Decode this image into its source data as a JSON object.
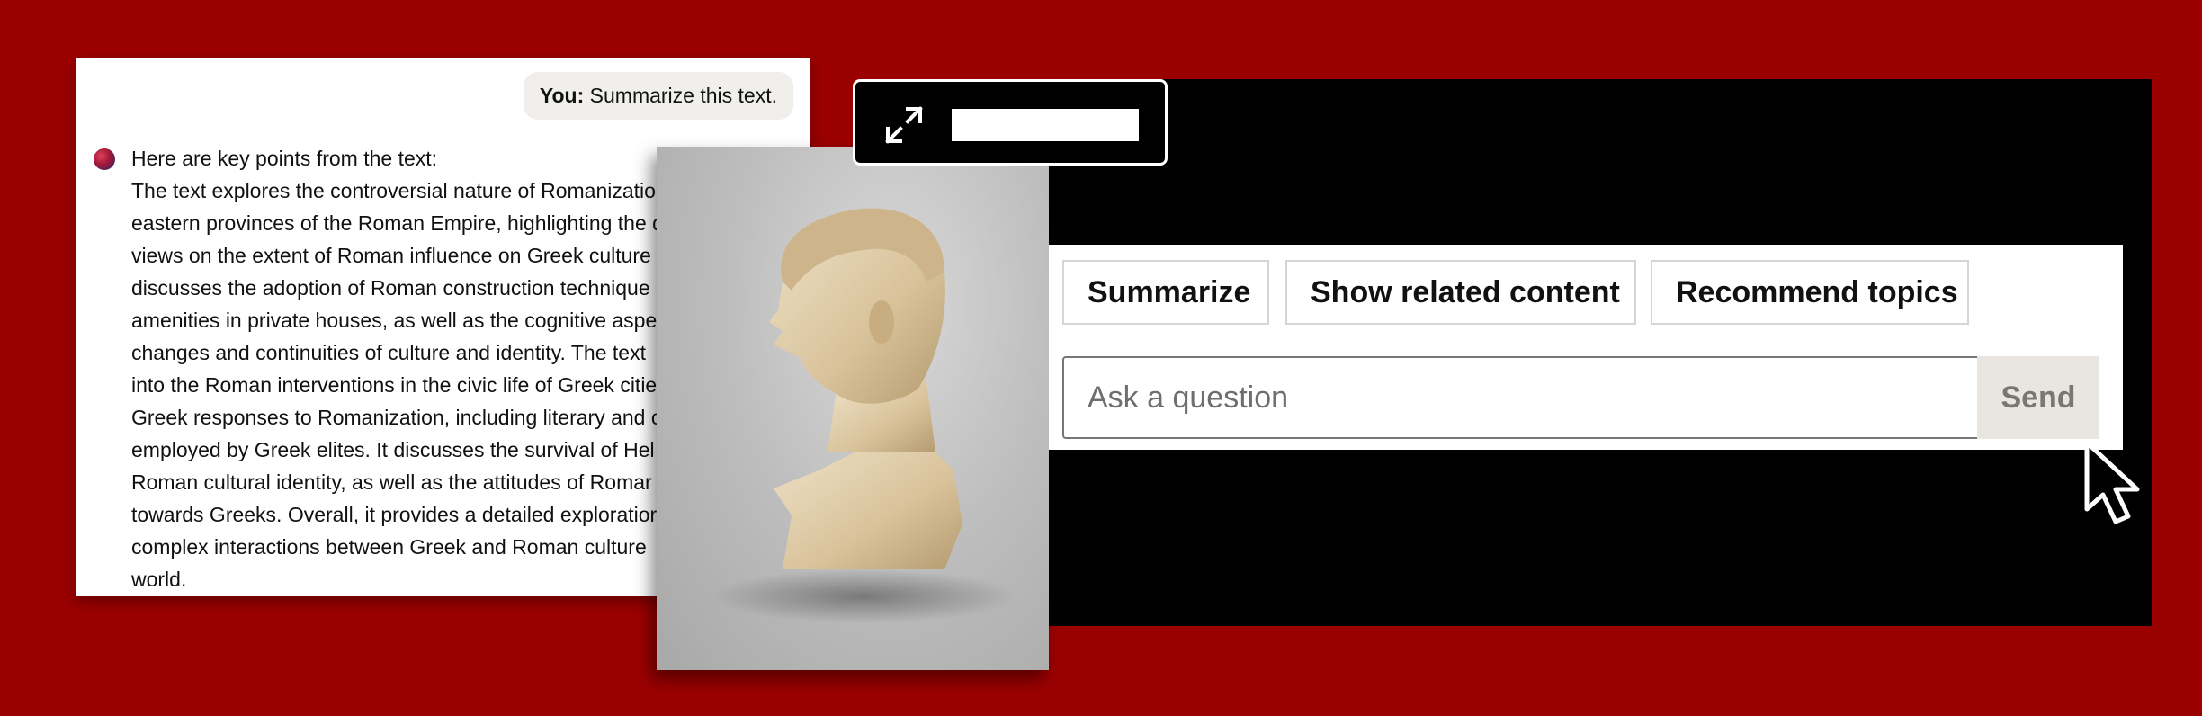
{
  "chat": {
    "user_label": "You:",
    "user_message": "Summarize this text.",
    "assistant_lines": [
      "Here are key points from the text:",
      "The text explores the controversial nature of Romanizatio",
      "eastern provinces of the Roman Empire, highlighting the d",
      "views on the extent of Roman influence on Greek culture",
      "discusses the adoption of Roman construction technique",
      "amenities in private houses, as well as the cognitive aspe",
      "changes and continuities of culture and identity. The text",
      "into the Roman interventions in the civic life of Greek citie",
      "Greek responses to Romanization, including literary and c",
      "employed by Greek elites. It discusses the survival of Hel",
      "Roman cultural identity, as well as the attitudes of Romar",
      "towards Greeks. Overall, it provides a detailed exploratior",
      "complex interactions between Greek and Roman culture",
      "world."
    ]
  },
  "toolbar": {
    "expand_icon": "expand-arrows-icon"
  },
  "actions": {
    "chips": [
      "Summarize",
      "Show related content",
      "Recommend topics"
    ],
    "question_placeholder": "Ask a question",
    "send_label": "Send"
  },
  "colors": {
    "background": "#9b0000",
    "panel": "#000000",
    "send_bg": "#e9e6e1"
  }
}
